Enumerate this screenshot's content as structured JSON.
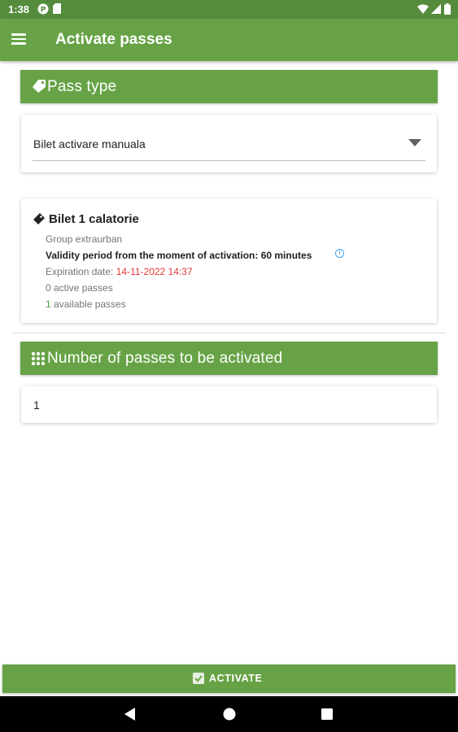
{
  "status_bar": {
    "time": "1:38",
    "icons": [
      "notification-p-icon",
      "sd-card-icon",
      "wifi-icon",
      "signal-icon",
      "battery-icon"
    ]
  },
  "app_bar": {
    "title": "Activate passes",
    "menu_icon": "hamburger-menu-icon"
  },
  "pass_type_section": {
    "header": "Pass type",
    "icon": "tag-icon",
    "selected_value": "Bilet activare manuala"
  },
  "pass_card": {
    "title": "Bilet 1 calatorie",
    "group": "Group extraurban",
    "validity": "Validity period from the moment of activation: 60 minutes",
    "expiration_label": "Expiration date: ",
    "expiration_value": "14-11-2022 14:37",
    "active_passes": "0 active passes",
    "available_count": "1",
    "available_label": " available passes"
  },
  "number_section": {
    "header": "Number of passes to be activated",
    "icon": "grid-dots-icon",
    "value": "1"
  },
  "activate_button": {
    "label": "ACTIVATE",
    "icon": "checkbox-icon"
  },
  "colors": {
    "primary": "#67a346",
    "status_bar": "#558b3c",
    "expiration": "#e53935",
    "available": "#43a047"
  }
}
